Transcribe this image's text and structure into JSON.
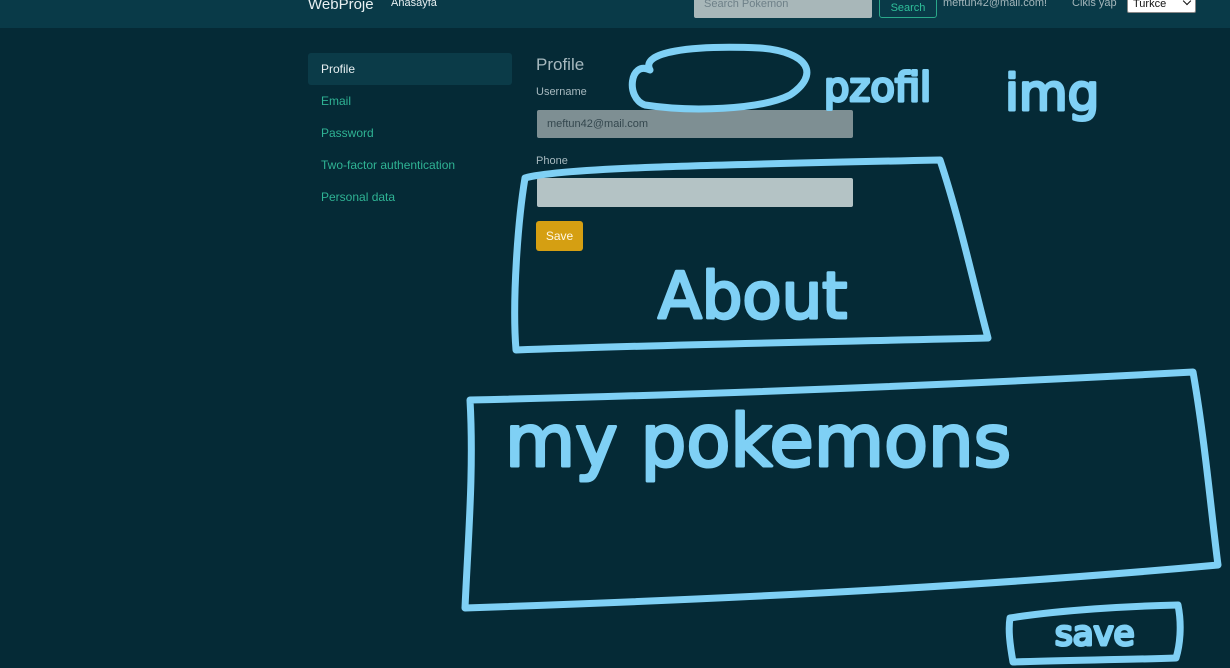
{
  "navbar": {
    "brand": "WebProje",
    "home_link": "Anasayfa",
    "search_placeholder": "Search Pokemon",
    "search_button": "Search",
    "user_email": "meftun42@mail.com!",
    "logout": "Cikis yap",
    "language": "Turkce"
  },
  "sidebar": {
    "items": [
      {
        "label": "Profile",
        "active": true
      },
      {
        "label": "Email",
        "active": false
      },
      {
        "label": "Password",
        "active": false
      },
      {
        "label": "Two-factor authentication",
        "active": false
      },
      {
        "label": "Personal data",
        "active": false
      }
    ]
  },
  "main": {
    "title": "Profile",
    "username_label": "Username",
    "username_value": "meftun42@mail.com",
    "phone_label": "Phone",
    "phone_value": "",
    "save_label": "Save"
  },
  "annotations": {
    "color": "#7fd0f5",
    "profile_img_note_1": "pzofil",
    "profile_img_note_2": "img",
    "about_note": "About",
    "pokemons_note": "my pokemons",
    "save_note": "save"
  }
}
